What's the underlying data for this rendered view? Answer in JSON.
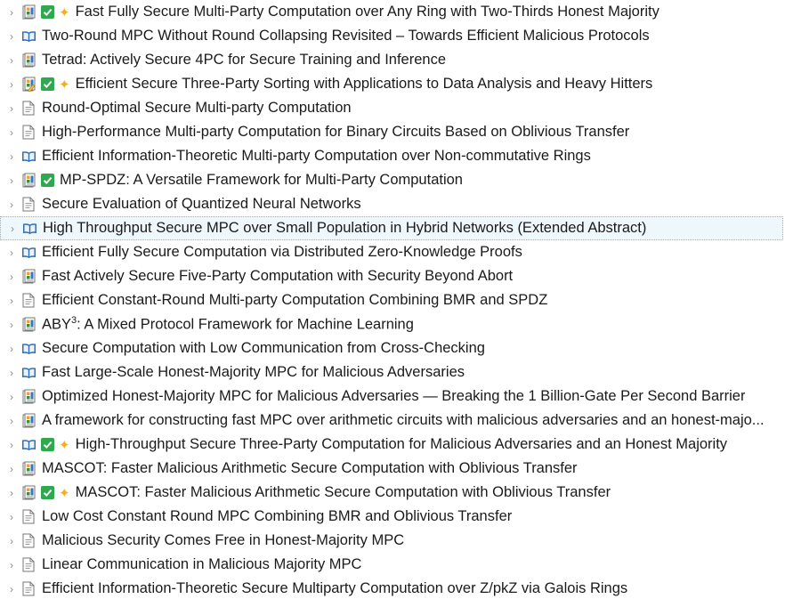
{
  "items": [
    {
      "icon": "journal-article-icon",
      "checked": true,
      "starred": true,
      "title": "Fast Fully Secure Multi-Party Computation over Any Ring with Two-Thirds Honest Majority"
    },
    {
      "icon": "book-icon",
      "checked": false,
      "starred": false,
      "title": "Two-Round MPC Without Round Collapsing Revisited – Towards Efficient Malicious Protocols"
    },
    {
      "icon": "journal-article-icon",
      "checked": false,
      "starred": false,
      "title": "Tetrad: Actively Secure 4PC for Secure Training and Inference"
    },
    {
      "icon": "journal-article-edit-icon",
      "checked": true,
      "starred": true,
      "title": "Efficient Secure Three-Party Sorting with Applications to Data Analysis and Heavy Hitters"
    },
    {
      "icon": "document-icon",
      "checked": false,
      "starred": false,
      "title": "Round-Optimal Secure Multi-party Computation"
    },
    {
      "icon": "document-icon",
      "checked": false,
      "starred": false,
      "title": "High-Performance Multi-party Computation for Binary Circuits Based on Oblivious Transfer"
    },
    {
      "icon": "book-icon",
      "checked": false,
      "starred": false,
      "title": "Efficient Information-Theoretic Multi-party Computation over Non-commutative Rings"
    },
    {
      "icon": "journal-article-icon",
      "checked": true,
      "starred": false,
      "title": "MP-SPDZ: A Versatile Framework for Multi-Party Computation"
    },
    {
      "icon": "document-icon",
      "checked": false,
      "starred": false,
      "title": "Secure Evaluation of Quantized Neural Networks"
    },
    {
      "icon": "book-icon",
      "checked": false,
      "starred": false,
      "selected": true,
      "title": "High Throughput Secure MPC over Small Population in Hybrid Networks (Extended Abstract)"
    },
    {
      "icon": "book-icon",
      "checked": false,
      "starred": false,
      "title": "Efficient Fully Secure Computation via Distributed Zero-Knowledge Proofs"
    },
    {
      "icon": "journal-article-icon",
      "checked": false,
      "starred": false,
      "title": "Fast Actively Secure Five-Party Computation with Security Beyond Abort"
    },
    {
      "icon": "document-icon",
      "checked": false,
      "starred": false,
      "title": "Efficient Constant-Round Multi-party Computation Combining BMR and SPDZ"
    },
    {
      "icon": "journal-article-icon",
      "checked": false,
      "starred": false,
      "title": "ABY",
      "title_sup": "3",
      "title_rest": ": A Mixed Protocol Framework for Machine Learning"
    },
    {
      "icon": "book-icon",
      "checked": false,
      "starred": false,
      "title": "Secure Computation with Low Communication from Cross-Checking"
    },
    {
      "icon": "book-icon",
      "checked": false,
      "starred": false,
      "title": "Fast Large-Scale Honest-Majority MPC for Malicious Adversaries"
    },
    {
      "icon": "journal-article-icon",
      "checked": false,
      "starred": false,
      "title": "Optimized Honest-Majority MPC for Malicious Adversaries — Breaking the 1 Billion-Gate Per Second Barrier"
    },
    {
      "icon": "journal-article-icon",
      "checked": false,
      "starred": false,
      "title": "A framework for constructing fast MPC over arithmetic circuits with malicious adversaries and an honest-majo..."
    },
    {
      "icon": "book-icon",
      "checked": true,
      "starred": true,
      "title": "High-Throughput Secure Three-Party Computation for Malicious Adversaries and an Honest Majority"
    },
    {
      "icon": "journal-article-icon",
      "checked": false,
      "starred": false,
      "title": "MASCOT: Faster Malicious Arithmetic Secure Computation with Oblivious Transfer"
    },
    {
      "icon": "journal-article-icon",
      "checked": true,
      "starred": true,
      "title": "MASCOT: Faster Malicious Arithmetic Secure Computation with Oblivious Transfer"
    },
    {
      "icon": "document-icon",
      "checked": false,
      "starred": false,
      "title": "Low Cost Constant Round MPC Combining BMR and Oblivious Transfer"
    },
    {
      "icon": "document-icon",
      "checked": false,
      "starred": false,
      "title": "Malicious Security Comes Free in Honest-Majority MPC"
    },
    {
      "icon": "document-icon",
      "checked": false,
      "starred": false,
      "title": "Linear Communication in Malicious Majority MPC"
    },
    {
      "icon": "document-icon",
      "checked": false,
      "starred": false,
      "title": "Efficient Information-Theoretic Secure Multiparty Computation over Z/pkZ via Galois Rings"
    }
  ]
}
